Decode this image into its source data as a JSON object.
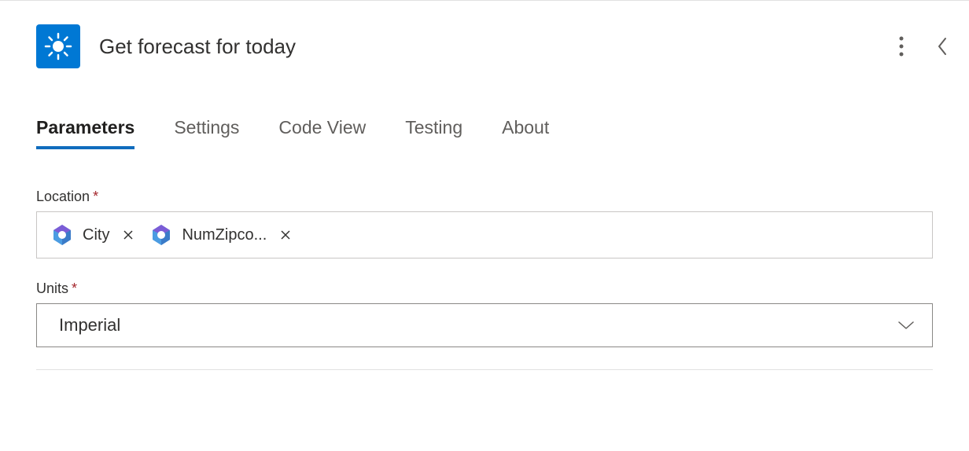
{
  "header": {
    "title": "Get forecast for today",
    "icon": "sun-icon",
    "iconBg": "#0078d4"
  },
  "tabs": [
    {
      "label": "Parameters",
      "active": true
    },
    {
      "label": "Settings",
      "active": false
    },
    {
      "label": "Code View",
      "active": false
    },
    {
      "label": "Testing",
      "active": false
    },
    {
      "label": "About",
      "active": false
    }
  ],
  "fields": {
    "location": {
      "label": "Location",
      "required": true,
      "tokens": [
        {
          "label": "City",
          "icon": "dynamic-content-icon"
        },
        {
          "label": "NumZipco...",
          "icon": "dynamic-content-icon"
        }
      ]
    },
    "units": {
      "label": "Units",
      "required": true,
      "value": "Imperial"
    }
  }
}
